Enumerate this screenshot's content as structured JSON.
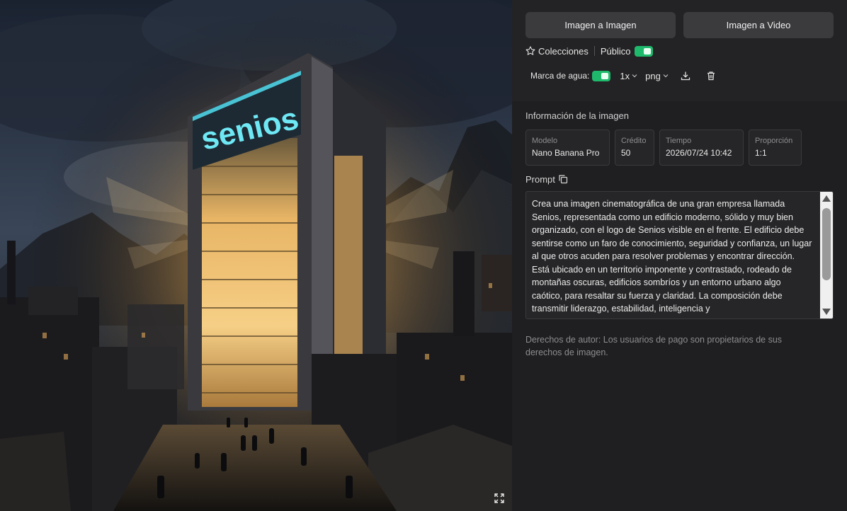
{
  "image": {
    "sign_text": "senios",
    "expand_icon": "expand-icon"
  },
  "actions": {
    "image_to_image": "Imagen a Imagen",
    "image_to_video": "Imagen a Video"
  },
  "meta": {
    "collections_label": "Colecciones",
    "collections_icon": "star-icon",
    "public_label": "Público",
    "public_on": true
  },
  "toolbar": {
    "watermark_label": "Marca de agua:",
    "watermark_on": true,
    "scale_value": "1x",
    "format_value": "png",
    "download_icon": "download-icon",
    "delete_icon": "trash-icon"
  },
  "info": {
    "title": "Información de la imagen",
    "cards": [
      {
        "key": "Modelo",
        "value": "Nano Banana Pro"
      },
      {
        "key": "Crédito",
        "value": "50"
      },
      {
        "key": "Tiempo",
        "value": "2026/07/24 10:42"
      },
      {
        "key": "Proporción",
        "value": "1:1"
      }
    ]
  },
  "prompt": {
    "label": "Prompt",
    "copy_icon": "copy-icon",
    "text": "Crea una imagen cinematográfica de una gran empresa llamada Senios, representada como un edificio moderno, sólido y muy bien organizado, con el logo de Senios visible en el frente. El edificio debe sentirse como un faro de conocimiento, seguridad y confianza, un lugar al que otros acuden para resolver problemas y encontrar dirección. Está ubicado en un territorio imponente y contrastado, rodeado de montañas oscuras, edificios sombríos y un entorno urbano algo caótico, para resaltar su fuerza y claridad. La composición debe transmitir liderazgo, estabilidad, inteligencia y"
  },
  "copyright": "Derechos de autor: Los usuarios de pago son propietarios de sus derechos de imagen.",
  "colors": {
    "accent_green": "#1fb96c",
    "panel_bg": "#1f1f21",
    "button_bg": "#3b3b3e",
    "sign_cyan": "#5fe3f0"
  }
}
